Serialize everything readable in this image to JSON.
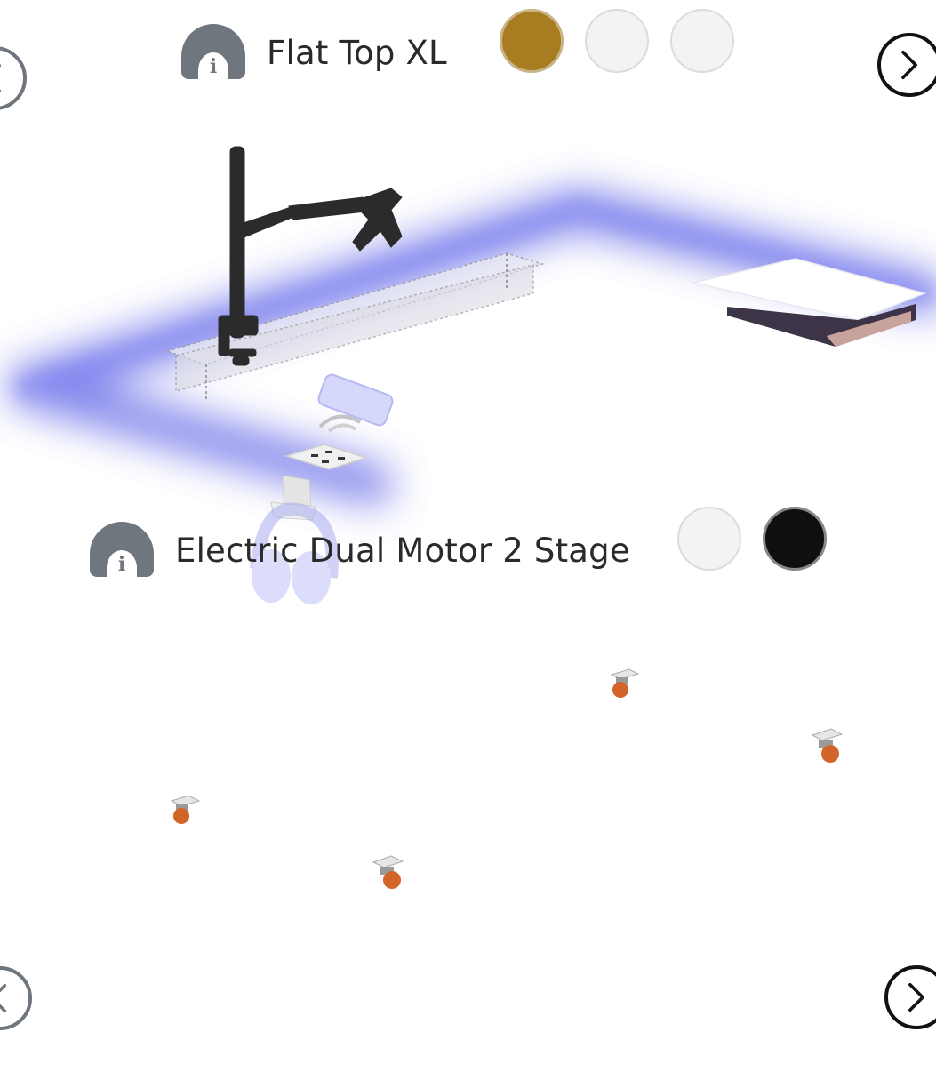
{
  "sections": [
    {
      "title": "Flat Top XL",
      "swatches": [
        {
          "name": "gold",
          "color": "#a87d22",
          "selected": true
        },
        {
          "name": "white",
          "color": "#f3f3f3",
          "selected": false
        },
        {
          "name": "white-2",
          "color": "#f3f3f3",
          "selected": false
        }
      ]
    },
    {
      "title": "Electric Dual Motor 2 Stage",
      "swatches": [
        {
          "name": "white",
          "color": "#f3f3f3",
          "selected": false
        },
        {
          "name": "black",
          "color": "#0f0f0f",
          "selected": true
        }
      ]
    }
  ],
  "icons": {
    "info": "info-icon",
    "prev": "chevron-left-icon",
    "next": "chevron-right-icon"
  },
  "accents": {
    "highlight": "#5a5ee6",
    "caster": "#d2642a",
    "arm": "#2b2b2b"
  }
}
